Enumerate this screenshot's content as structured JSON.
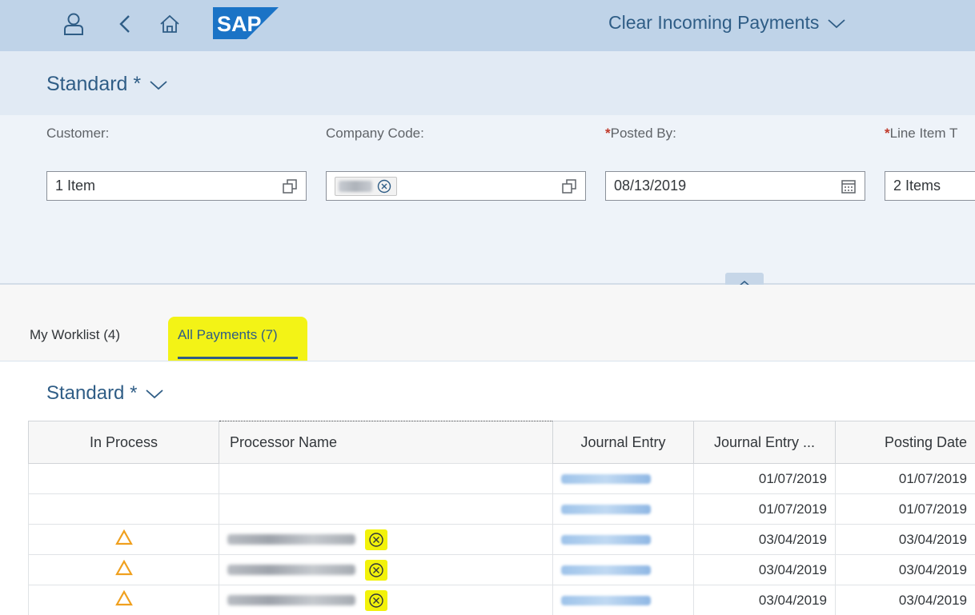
{
  "shell": {
    "app_title": "Clear Incoming Payments",
    "logo_text": "SAP",
    "colors": {
      "bar": "#bfd3e8",
      "logo": "#1a73c6"
    }
  },
  "variant": {
    "title": "Standard *"
  },
  "filters": [
    {
      "label": "Customer:",
      "required": false,
      "value": "1 Item",
      "trail_icon": "value-help-icon"
    },
    {
      "label": "Company Code:",
      "required": false,
      "value": "",
      "token": "redacted",
      "trail_icon": "value-help-icon"
    },
    {
      "label": "Posted By:",
      "required": true,
      "value": "08/13/2019",
      "trail_icon": "calendar-icon"
    },
    {
      "label": "Line Item T",
      "required": true,
      "value": "2 Items",
      "trail_icon": ""
    }
  ],
  "required_marker": "*",
  "tabs": [
    {
      "label": "My Worklist (4)",
      "active": false
    },
    {
      "label": "All Payments (7)",
      "active": true
    }
  ],
  "table": {
    "title": "Standard *",
    "columns": [
      "In Process",
      "Processor Name",
      "Journal Entry",
      "Journal Entry ...",
      "Posting Date"
    ],
    "rows": [
      {
        "in_process": false,
        "processor": false,
        "je_date": "01/07/2019",
        "posting_date": "01/07/2019"
      },
      {
        "in_process": false,
        "processor": false,
        "je_date": "01/07/2019",
        "posting_date": "01/07/2019"
      },
      {
        "in_process": true,
        "processor": true,
        "je_date": "03/04/2019",
        "posting_date": "03/04/2019"
      },
      {
        "in_process": true,
        "processor": true,
        "je_date": "03/04/2019",
        "posting_date": "03/04/2019"
      },
      {
        "in_process": true,
        "processor": true,
        "je_date": "03/04/2019",
        "posting_date": "03/04/2019"
      }
    ],
    "colors": {
      "warning": "#f0a01e",
      "link": "#0a6ed1",
      "highlight": "#f2f20a"
    }
  }
}
